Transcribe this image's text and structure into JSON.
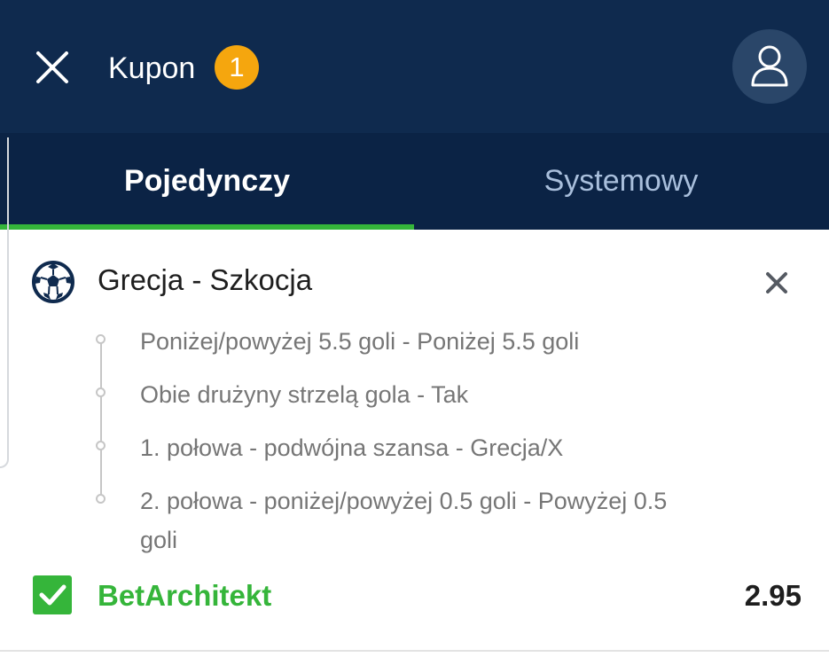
{
  "header": {
    "title": "Kupon",
    "selection_count": "1",
    "icons": {
      "close": "close-icon",
      "user": "user-icon"
    },
    "colors": {
      "background": "#0f2a4e",
      "badge": "#f5a60e"
    }
  },
  "tabs": [
    {
      "label": "Pojedynczy",
      "active": true
    },
    {
      "label": "Systemowy",
      "active": false
    }
  ],
  "event": {
    "name": "Grecja - Szkocja",
    "sport_icon": "football-icon",
    "selections": [
      "Poniżej/powyżej 5.5 goli - Poniżej 5.5 goli",
      "Obie drużyny strzelą gola - Tak",
      "1. połowa - podwójna szansa - Grecja/X",
      "2. połowa - poniżej/powyżej 0.5 goli - Powyżej 0.5 goli"
    ],
    "bet_builder": {
      "label": "BetArchitekt",
      "checked": true
    },
    "odds": "2.95"
  },
  "accent_color": "#35b53a"
}
